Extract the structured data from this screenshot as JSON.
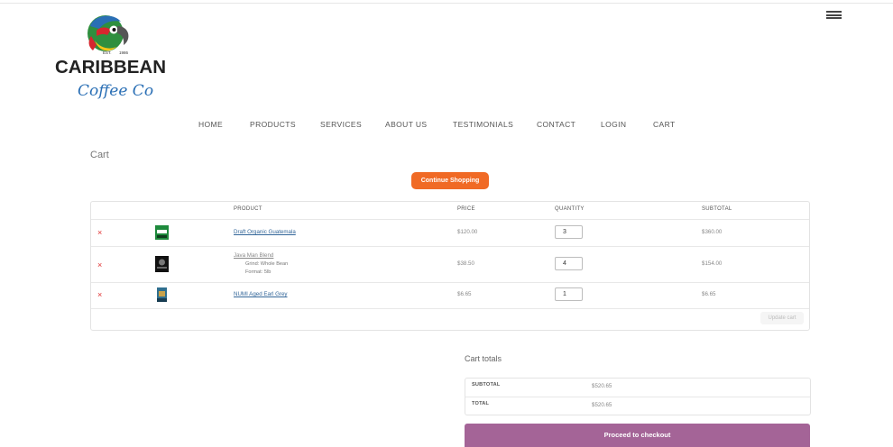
{
  "brand": {
    "line1": "CARIBBEAN",
    "line2": "Coffee Co",
    "est_left": "EST.",
    "est_right": "1986",
    "colors": {
      "green": "#2f8f3f",
      "red": "#d7262e",
      "blue": "#2a6fb5",
      "yellow": "#f5c518"
    }
  },
  "menu_icon": "hamburger-icon",
  "nav": {
    "items": [
      {
        "label": "HOME"
      },
      {
        "label": "PRODUCTS"
      },
      {
        "label": "SERVICES"
      },
      {
        "label": "ABOUT US"
      },
      {
        "label": "TESTIMONIALS"
      },
      {
        "label": "CONTACT"
      },
      {
        "label": "LOGIN"
      },
      {
        "label": "CART"
      }
    ]
  },
  "page": {
    "title": "Cart"
  },
  "cart": {
    "continue_label": "Continue Shopping",
    "headers": {
      "product": "PRODUCT",
      "price": "PRICE",
      "quantity": "QUANTITY",
      "subtotal": "SUBTOTAL"
    },
    "remove_symbol": "×",
    "items": [
      {
        "name": "Draft Organic Guatemala",
        "price": "$120.00",
        "quantity": "3",
        "subtotal": "$360.00",
        "meta": []
      },
      {
        "name": "Java Man Blend",
        "price": "$38.50",
        "quantity": "4",
        "subtotal": "$154.00",
        "meta": [
          {
            "label": "Grind:",
            "value": "Whole Bean"
          },
          {
            "label": "Format:",
            "value": "5lb"
          }
        ]
      },
      {
        "name": "NUMI Aged Earl Grey",
        "price": "$6.65",
        "quantity": "1",
        "subtotal": "$6.65",
        "meta": []
      }
    ],
    "update_label": "Update cart"
  },
  "totals": {
    "title": "Cart totals",
    "rows": [
      {
        "label": "SUBTOTAL",
        "value": "$520.65"
      },
      {
        "label": "TOTAL",
        "value": "$520.65"
      }
    ],
    "checkout_label": "Proceed to checkout",
    "checkout_color": "#a46497"
  }
}
